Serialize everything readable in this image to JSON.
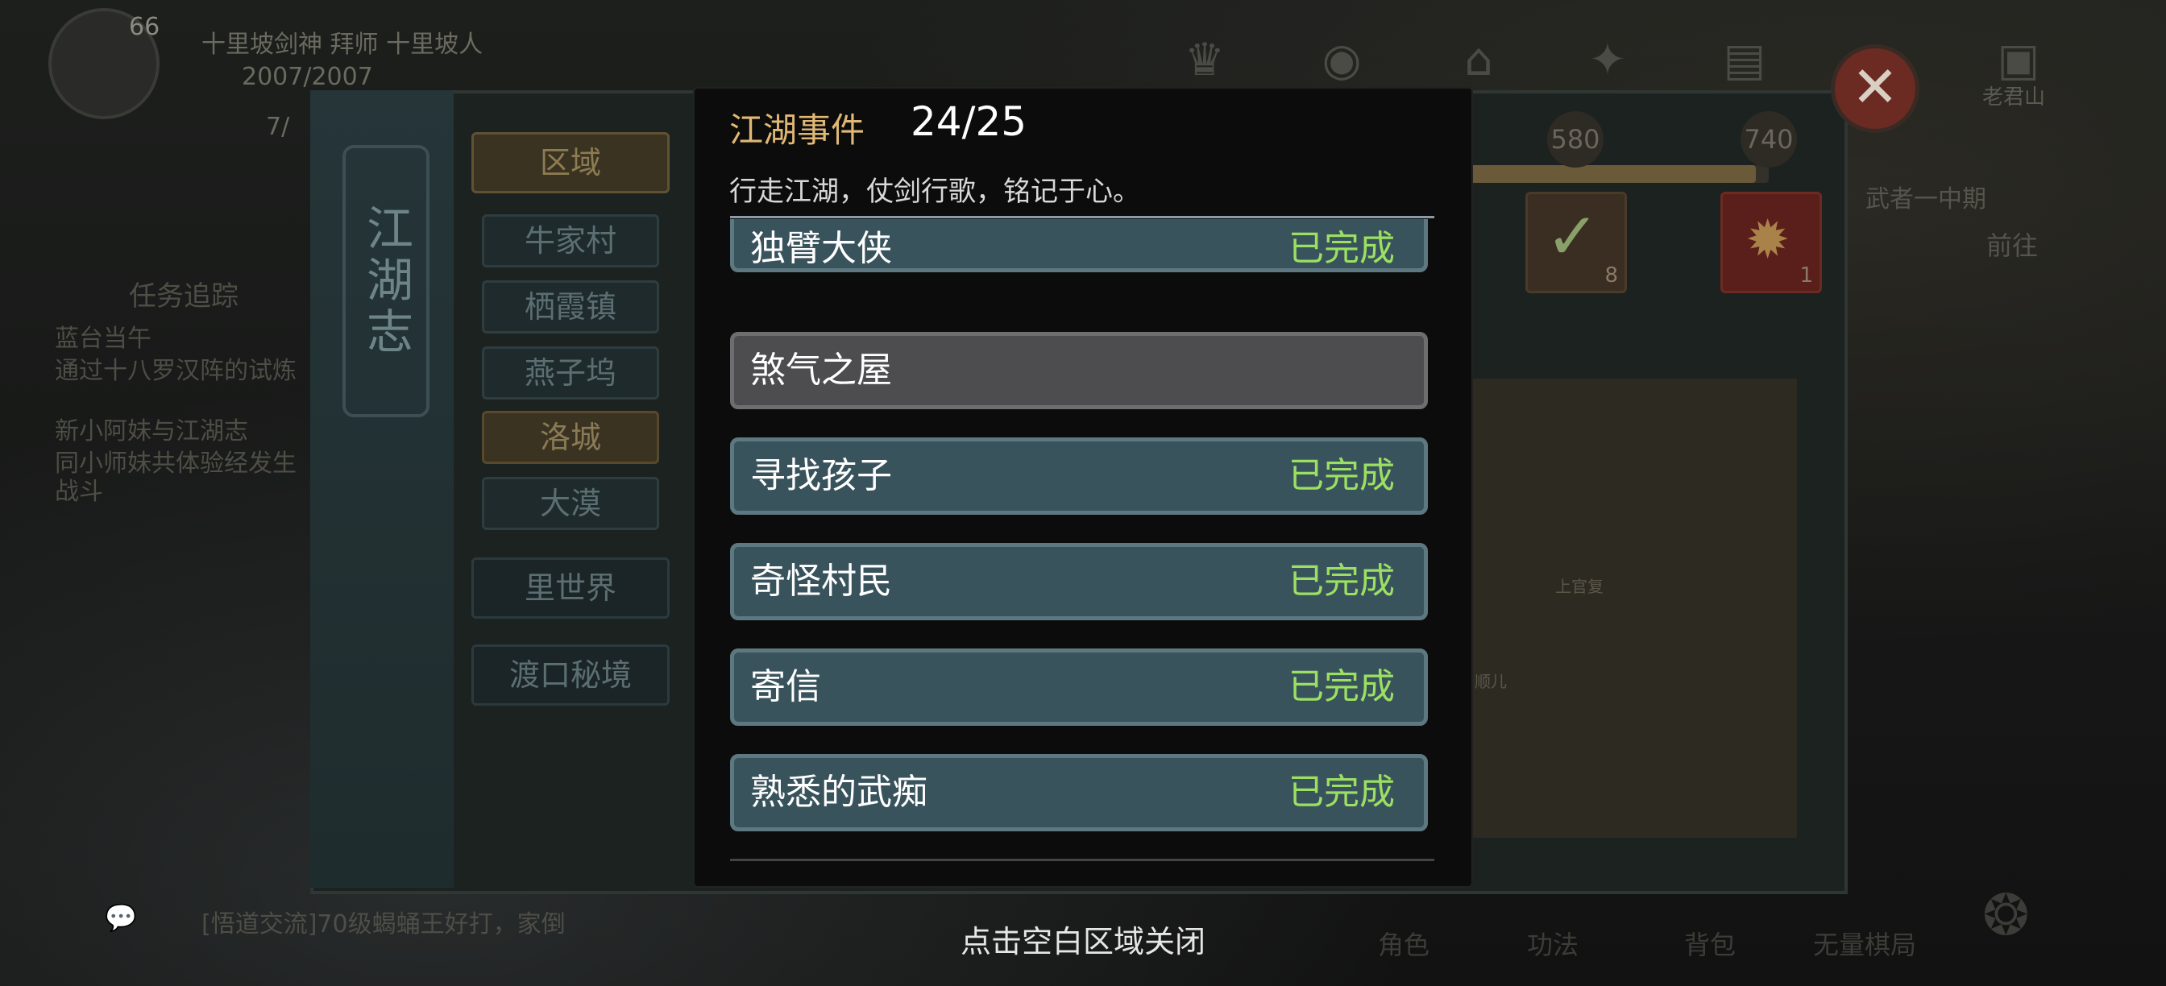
{
  "hud": {
    "level": "66",
    "player_title": "十里坡剑神  拜师  十里坡人",
    "hp": "2007/2007",
    "stat": "7/",
    "top_right_label": "老君山"
  },
  "book": {
    "title": "江湖志",
    "tabs": [
      {
        "label": "区域",
        "type": "region"
      },
      {
        "label": "牛家村",
        "type": "normal"
      },
      {
        "label": "栖霞镇",
        "type": "normal"
      },
      {
        "label": "燕子坞",
        "type": "normal"
      },
      {
        "label": "洛城",
        "type": "selected"
      },
      {
        "label": "大漠",
        "type": "normal"
      },
      {
        "label": "里世界",
        "type": "big"
      },
      {
        "label": "渡口秘境",
        "type": "big"
      }
    ],
    "milestones": [
      "580",
      "740"
    ],
    "progress_fraction": 0.96,
    "rewards": [
      "8",
      "1"
    ],
    "npc_labels": [
      "上官复",
      "顺儿"
    ],
    "region_label": "武者一中期",
    "goto_label": "前往"
  },
  "side": {
    "quest_header": "任务追踪",
    "quest_lines": [
      "蓝台当午",
      "通过十八罗汉阵的试炼",
      "新小阿妹与江湖志",
      "同小师妹共体验经发生",
      "战斗"
    ]
  },
  "modal": {
    "title": "江湖事件",
    "count": "24/25",
    "subtitle": "行走江湖，仗剑行歌，铭记于心。",
    "items": [
      {
        "name": "独臂大侠",
        "status": "已完成",
        "style": "done"
      },
      {
        "name": "煞气之屋",
        "status": "",
        "style": "pending"
      },
      {
        "name": "寻找孩子",
        "status": "已完成",
        "style": "done"
      },
      {
        "name": "奇怪村民",
        "status": "已完成",
        "style": "done"
      },
      {
        "name": "寄信",
        "status": "已完成",
        "style": "done"
      },
      {
        "name": "熟悉的武痴",
        "status": "已完成",
        "style": "done"
      }
    ],
    "close_hint": "点击空白区域关闭"
  },
  "chat": {
    "message": "[悟道交流]70级蝎蛹王好打，家倒"
  },
  "bottom_nav": [
    "角色",
    "功法",
    "背包",
    "无量棋局"
  ]
}
